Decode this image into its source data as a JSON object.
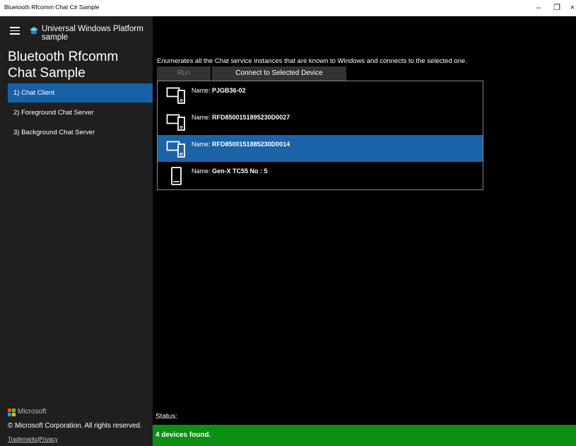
{
  "window": {
    "title": "Bluetooth Rfcomm Chat C# Sample",
    "minimize": "–",
    "restore": "❐",
    "close": "×"
  },
  "debug_toolbar": {
    "icons": [
      "select-element-icon",
      "display-layout-icon",
      "track-focus-icon",
      "live-visual-tree-icon"
    ]
  },
  "sidebar": {
    "app_name": "Universal Windows Platform sample",
    "scenario_title": "Bluetooth Rfcomm Chat Sample",
    "items": [
      {
        "label": "1) Chat Client",
        "active": true
      },
      {
        "label": "2) Foreground Chat Server",
        "active": false
      },
      {
        "label": "3) Background Chat Server",
        "active": false
      }
    ],
    "footer": {
      "company": "Microsoft",
      "copyright": "© Microsoft Corporation. All rights reserved.",
      "trademarks": "Trademarks",
      "separator": "|",
      "privacy": "Privacy"
    }
  },
  "main": {
    "description": "Enumerates all the Chat service instances that are known to Windows and connects to the selected one.",
    "run_button": "Run",
    "connect_button": "Connect to Selected Device",
    "devices": [
      {
        "prefix": "Name:",
        "name": "PJGB36-02",
        "icon": "device-pair-icon",
        "selected": false
      },
      {
        "prefix": "Name:",
        "name": "RFD8500151895230D0027",
        "icon": "device-pair-icon",
        "selected": false
      },
      {
        "prefix": "Name:",
        "name": "RFD8500151885230D0014",
        "icon": "device-pair-icon",
        "selected": true
      },
      {
        "prefix": "Name:",
        "name": "Gen-X TC55 No : 5",
        "icon": "phone-icon",
        "selected": false
      }
    ],
    "status_label": "Status:",
    "status_message": "4 devices found.",
    "status_color": "#0c8f13"
  },
  "colors": {
    "accent": "#1661a6",
    "sidebar_bg": "#1f1f1f",
    "main_bg": "#000000"
  }
}
